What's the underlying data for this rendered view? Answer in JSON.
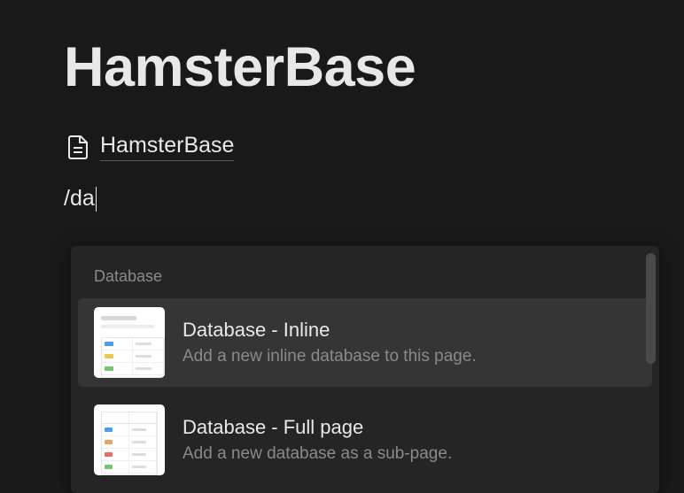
{
  "page": {
    "title": "HamsterBase"
  },
  "breadcrumb": {
    "label": "HamsterBase"
  },
  "slash": {
    "input": "/da"
  },
  "popup": {
    "section_label": "Database",
    "items": [
      {
        "title": "Database - Inline",
        "description": "Add a new inline database to this page.",
        "thumb": "inline"
      },
      {
        "title": "Database - Full page",
        "description": "Add a new database as a sub-page.",
        "thumb": "fullpage"
      }
    ]
  },
  "colors": {
    "bg": "#191919",
    "panel": "#252525",
    "hover": "#353535",
    "text": "#e8e8e7",
    "muted": "#8a8a88"
  }
}
